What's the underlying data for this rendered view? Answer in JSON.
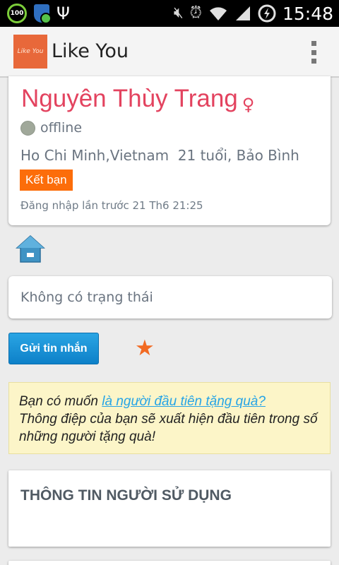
{
  "status_bar": {
    "battery_percent": "100",
    "time": "15:48",
    "icons": [
      "battery-percent-icon",
      "security-shield-icon",
      "usb-icon",
      "mute-icon",
      "alarm-icon",
      "wifi-icon",
      "signal-icon",
      "data-sync-icon"
    ]
  },
  "action_bar": {
    "logo_text": "Like You",
    "title": "Like You"
  },
  "profile": {
    "name": "Nguyên Thùy Trang",
    "gender_icon": "female-icon",
    "online_status": "offline",
    "location": "Ho Chi Minh,Vietnam  21 tuổi, Bảo Bình",
    "add_friend_label": "Kết bạn",
    "last_login": "Đăng nhập lần trước 21 Th6 21:25"
  },
  "status_message": "Không có trạng thái",
  "send_message_label": "Gửi tin nhắn",
  "gift": {
    "prefix": "Bạn có muốn ",
    "link_text": "là người đầu tiên tặng quà?",
    "message": "Thông điệp của bạn sẽ xuất hiện đầu tiên trong số những người tặng quà!"
  },
  "user_info_heading": "THÔNG TIN NGƯỜI SỬ DỤNG",
  "colors": {
    "name_pink": "#e3435f",
    "accent_orange": "#fc6d0a",
    "button_blue": "#1a92d6",
    "gift_bg": "#fcf5c8",
    "link_blue": "#26a4e6"
  }
}
